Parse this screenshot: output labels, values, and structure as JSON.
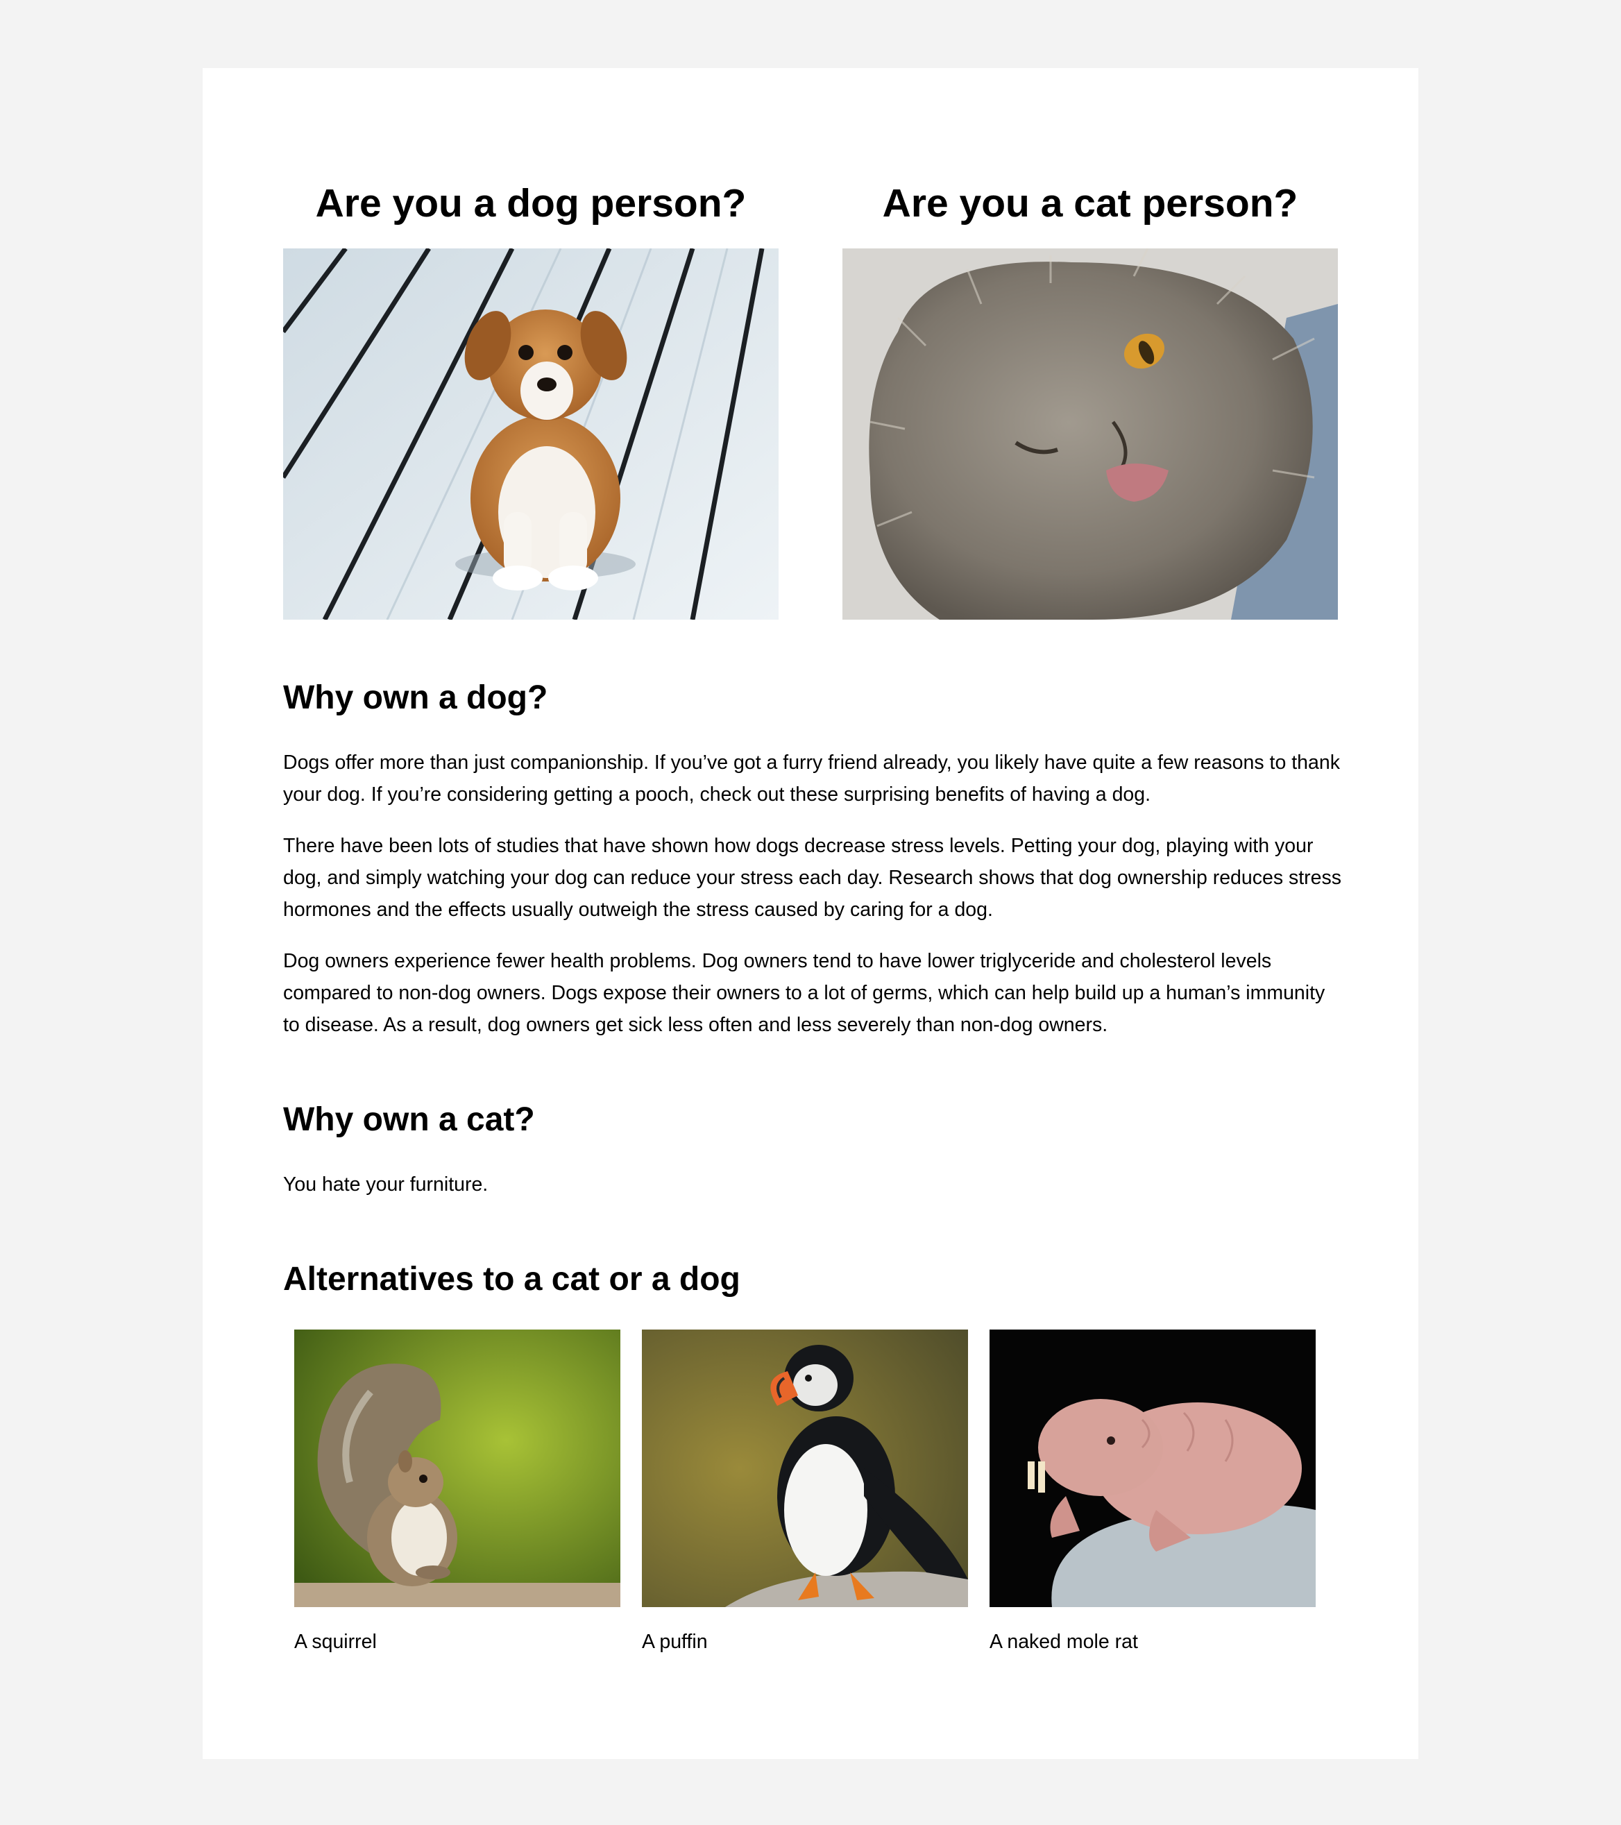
{
  "hero": {
    "dog_title": "Are you a dog person?",
    "cat_title": "Are you a cat person?"
  },
  "dog_section": {
    "title": "Why own a dog?",
    "paragraphs": [
      "Dogs offer more than just companionship. If you’ve got a furry friend already, you likely have quite a few reasons to thank your dog. If you’re considering getting a pooch, check out these surprising benefits of having a dog.",
      "There have been lots of studies that have shown how dogs decrease stress levels. Petting your dog, playing with your dog, and simply watching your dog can reduce your stress each day. Research shows that dog ownership reduces stress hormones and the effects usually outweigh the stress caused by caring for a dog.",
      "Dog owners experience fewer health problems. Dog owners tend to have lower triglyceride and cholesterol levels compared to non-dog owners. Dogs expose their owners to a lot of germs, which can help build up a human’s immunity to disease. As a result, dog owners get sick less often and less severely than non-dog owners."
    ]
  },
  "cat_section": {
    "title": "Why own a cat?",
    "paragraph": "You hate your furniture."
  },
  "alternatives": {
    "title": "Alternatives to a cat or a dog",
    "items": [
      {
        "caption": "A squirrel"
      },
      {
        "caption": "A puffin"
      },
      {
        "caption": "A naked mole rat"
      }
    ]
  }
}
